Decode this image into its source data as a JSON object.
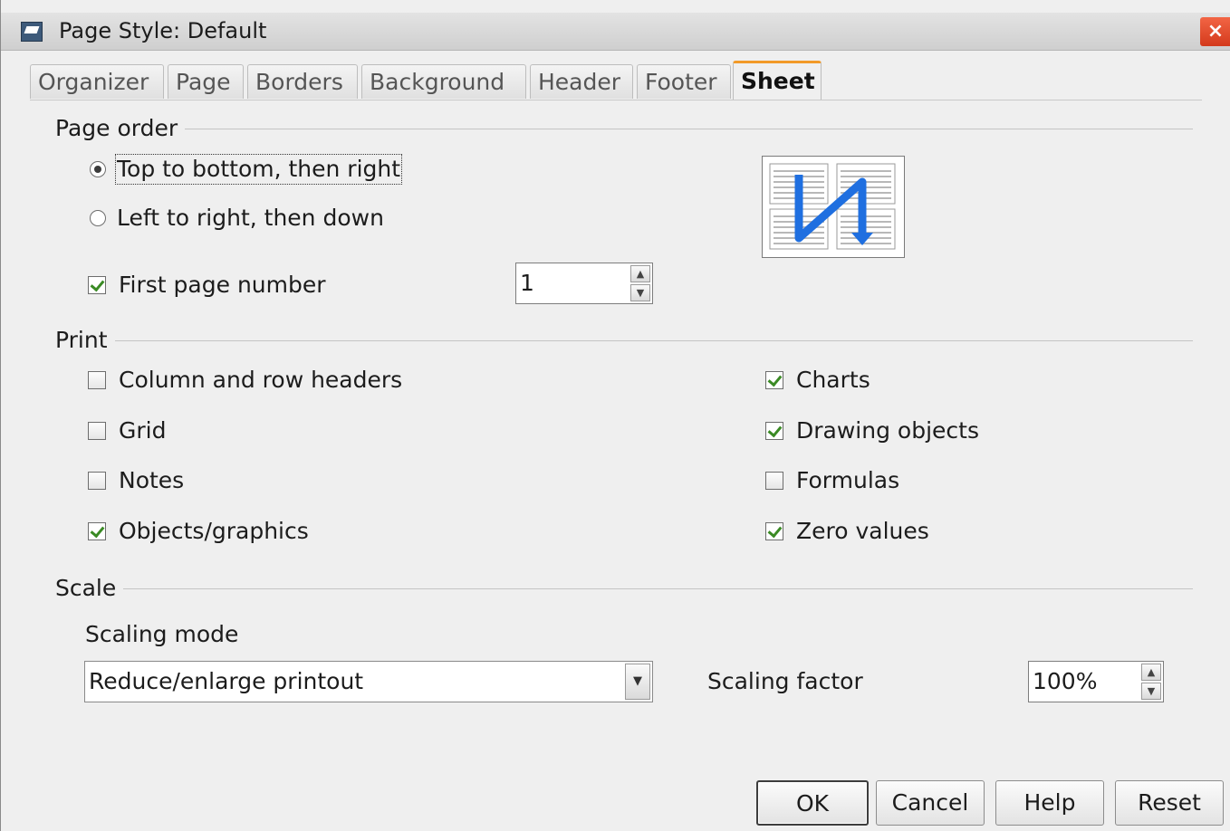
{
  "window": {
    "title": "Page Style: Default",
    "close_label": "×"
  },
  "tabs": [
    {
      "label": "Organizer"
    },
    {
      "label": "Page"
    },
    {
      "label": "Borders"
    },
    {
      "label": "Background"
    },
    {
      "label": "Header"
    },
    {
      "label": "Footer"
    },
    {
      "label": "Sheet",
      "active": true
    }
  ],
  "page_order": {
    "title": "Page order",
    "options": [
      {
        "label": "Top to bottom, then right",
        "selected": true
      },
      {
        "label": "Left to right, then down",
        "selected": false
      }
    ],
    "first_page_number": {
      "label": "First page number",
      "checked": true,
      "value": "1"
    }
  },
  "print": {
    "title": "Print",
    "left": [
      {
        "label": "Column and row headers",
        "checked": false
      },
      {
        "label": "Grid",
        "checked": false
      },
      {
        "label": "Notes",
        "checked": false
      },
      {
        "label": "Objects/graphics",
        "checked": true
      }
    ],
    "right": [
      {
        "label": "Charts",
        "checked": true
      },
      {
        "label": "Drawing objects",
        "checked": true
      },
      {
        "label": "Formulas",
        "checked": false
      },
      {
        "label": "Zero values",
        "checked": true
      }
    ]
  },
  "scale": {
    "title": "Scale",
    "mode_label": "Scaling mode",
    "mode_value": "Reduce/enlarge printout",
    "factor_label": "Scaling factor",
    "factor_value": "100%"
  },
  "buttons": {
    "ok": "OK",
    "cancel": "Cancel",
    "help": "Help",
    "reset": "Reset"
  },
  "colors": {
    "active_tab_accent": "#f29a28",
    "close_button": "#d43a1c",
    "preview_arrow": "#1f6fe0",
    "check_mark": "#3a8a24"
  }
}
